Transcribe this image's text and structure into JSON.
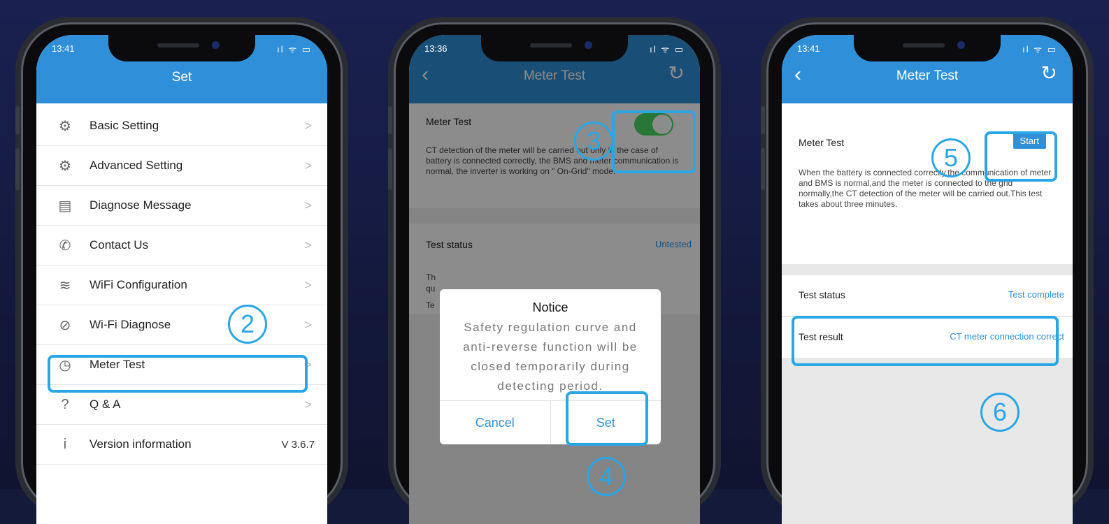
{
  "phone1": {
    "time": "13:41",
    "status_icons": "ıl ᯤ ▭",
    "title": "Set",
    "items": [
      {
        "icon": "gear-icon",
        "glyph": "⚙",
        "label": "Basic Setting"
      },
      {
        "icon": "advanced-gear-icon",
        "glyph": "⚙",
        "label": "Advanced Setting"
      },
      {
        "icon": "document-icon",
        "glyph": "▤",
        "label": "Diagnose Message"
      },
      {
        "icon": "phone-icon",
        "glyph": "✆",
        "label": "Contact Us"
      },
      {
        "icon": "wifi-icon",
        "glyph": "≋",
        "label": "WiFi Configuration"
      },
      {
        "icon": "wifi-diagnose-icon",
        "glyph": "⊘",
        "label": "Wi-Fi Diagnose"
      },
      {
        "icon": "meter-icon",
        "glyph": "◷",
        "label": "Meter Test"
      },
      {
        "icon": "question-icon",
        "glyph": "?",
        "label": "Q & A"
      },
      {
        "icon": "info-icon",
        "glyph": "i",
        "label": "Version information",
        "value": "V 3.6.7"
      }
    ],
    "chevron": ">",
    "step": "2"
  },
  "phone2": {
    "time": "13:36",
    "title": "Meter Test",
    "meter_test_label": "Meter Test",
    "description": "CT detection of the meter will be carried out only in the case of battery is connected correctly, the BMS and meter communication is normal, the inverter is working on \" On-Grid\" mode.",
    "test_status_label": "Test status",
    "test_status_value": "Untested",
    "partial_text": "Th",
    "partial_text2": "qu",
    "partial_text3": "Te",
    "dialog": {
      "title": "Notice",
      "message": "Safety regulation curve and anti-reverse function will be closed temporarily during detecting period.",
      "cancel": "Cancel",
      "set": "Set"
    },
    "step3": "3",
    "step4": "4"
  },
  "phone3": {
    "time": "13:41",
    "title": "Meter Test",
    "meter_test_label": "Meter Test",
    "start_label": "Start",
    "description": "When the battery is connected correctly,the communication of meter and BMS is normal,and the meter is connected to the grid normally,the CT detection of the meter will be carried out.This test takes about three minutes.",
    "test_status_label": "Test status",
    "test_status_value": "Test complete",
    "test_result_label": "Test result",
    "test_result_value": "CT meter connection correct",
    "step5": "5",
    "step6": "6"
  },
  "colors": {
    "accent": "#2f8fd8",
    "highlight": "#2aa6e6",
    "toggle_on": "#4cd964"
  }
}
